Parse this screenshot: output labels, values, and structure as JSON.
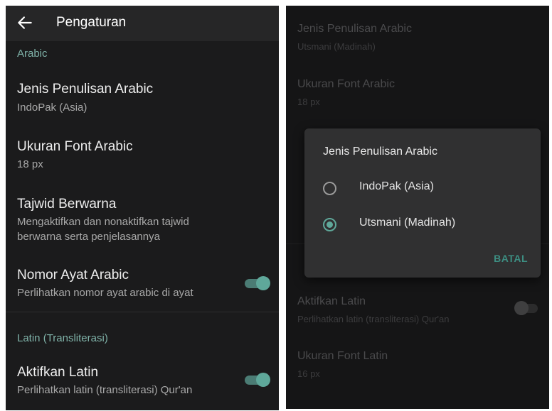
{
  "left": {
    "app_title": "Pengaturan",
    "sections": [
      {
        "header": "Arabic"
      },
      {
        "header": "Latin (Transliterasi)"
      }
    ],
    "items": [
      {
        "title": "Jenis Penulisan Arabic",
        "subtitle": "IndoPak (Asia)"
      },
      {
        "title": "Ukuran Font Arabic",
        "subtitle": "18 px"
      },
      {
        "title": "Tajwid Berwarna",
        "subtitle_line1": "Mengaktifkan dan nonaktifkan tajwid",
        "subtitle_line2": "berwarna serta penjelasannya"
      },
      {
        "title": "Nomor Ayat Arabic",
        "subtitle": "Perlihatkan nomor ayat arabic di ayat",
        "toggle": "on"
      },
      {
        "title": "Aktifkan Latin",
        "subtitle": "Perlihatkan latin (transliterasi) Qur'an",
        "toggle": "on"
      }
    ]
  },
  "right": {
    "background_items": [
      {
        "title": "Jenis Penulisan Arabic",
        "subtitle": "Utsmani (Madinah)"
      },
      {
        "title": "Ukuran Font Arabic",
        "subtitle": "18 px"
      },
      {
        "title": "Aktifkan Latin",
        "subtitle": "Perlihatkan latin (transliterasi) Qur'an",
        "toggle": "off"
      },
      {
        "title": "Ukuran Font Latin",
        "subtitle": "16 px"
      }
    ],
    "dialog": {
      "title": "Jenis Penulisan Arabic",
      "options": [
        {
          "label": "IndoPak (Asia)",
          "selected": false
        },
        {
          "label": "Utsmani (Madinah)",
          "selected": true
        }
      ],
      "cancel_label": "BATAL"
    }
  },
  "colors": {
    "accent": "#5fa89a",
    "section_header": "#7fb2a8",
    "background": "#1b1b1c",
    "dialog": "#303031"
  }
}
